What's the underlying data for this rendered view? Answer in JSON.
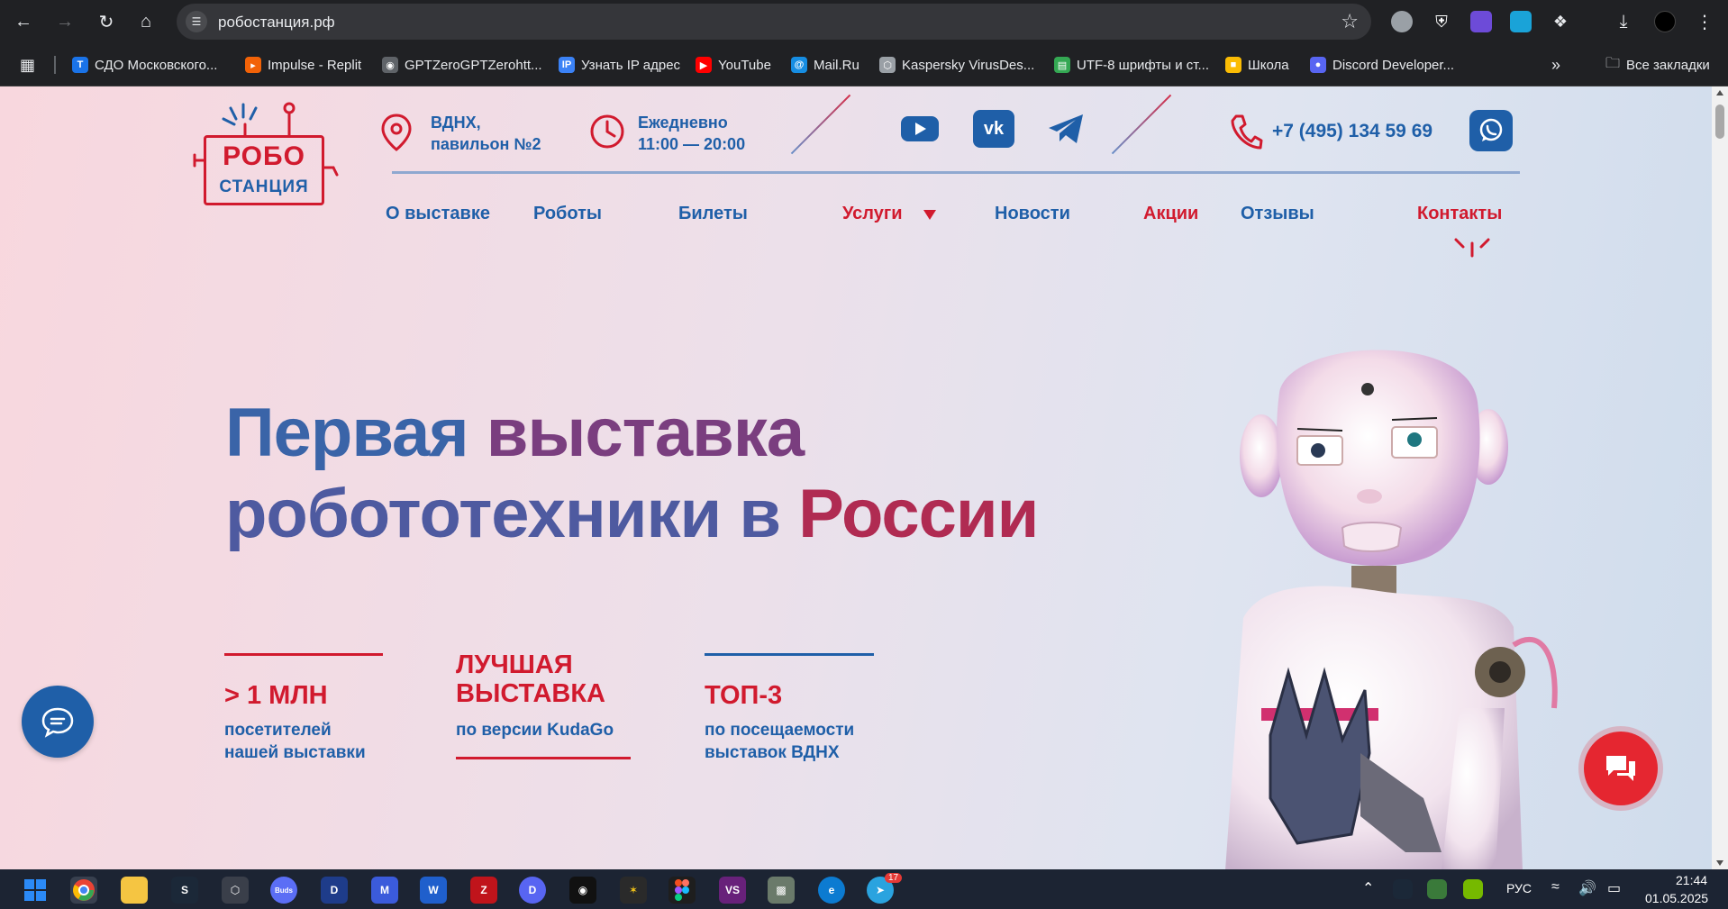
{
  "browser": {
    "url": "робостанция.рф",
    "bookmarks": [
      {
        "label": "СДО Московского...",
        "icon": "sdo-icon",
        "color": "#1a73e8"
      },
      {
        "label": "Impulse - Replit",
        "icon": "replit-icon",
        "color": "#f26207"
      },
      {
        "label": "GPTZeroGPTZerohtt...",
        "icon": "globe-icon",
        "color": "#5f6368"
      },
      {
        "label": "Узнать IP адрес",
        "icon": "ip-icon",
        "color": "#3b82f6"
      },
      {
        "label": "YouTube",
        "icon": "youtube-icon",
        "color": "#ff0000"
      },
      {
        "label": "Mail.Ru",
        "icon": "mailru-icon",
        "color": "#168de2"
      },
      {
        "label": "Kaspersky VirusDes...",
        "icon": "kaspersky-icon",
        "color": "#9aa0a6"
      },
      {
        "label": "UTF-8 шрифты и ст...",
        "icon": "doc-icon",
        "color": "#34a853"
      },
      {
        "label": "Школа",
        "icon": "school-icon",
        "color": "#fbbc04"
      },
      {
        "label": "Discord Developer...",
        "icon": "discord-icon",
        "color": "#5865f2"
      }
    ],
    "more_label": "»",
    "all_bookmarks": "Все закладки"
  },
  "site": {
    "logo": {
      "line1": "РОБО",
      "line2": "СТАНЦИЯ"
    },
    "address": {
      "line1": "ВДНХ,",
      "line2": "павильон №2"
    },
    "hours": {
      "line1": "Ежедневно",
      "line2": "11:00 — 20:00"
    },
    "phone": "+7 (495) 134 59 69",
    "menu": [
      {
        "label": "О выставке",
        "color": "blue"
      },
      {
        "label": "Роботы",
        "color": "blue"
      },
      {
        "label": "Билеты",
        "color": "blue"
      },
      {
        "label": "Услуги",
        "color": "red"
      },
      {
        "label": "Новости",
        "color": "blue"
      },
      {
        "label": "Акции",
        "color": "red"
      },
      {
        "label": "Отзывы",
        "color": "blue"
      },
      {
        "label": "Контакты",
        "color": "red"
      }
    ],
    "hero": {
      "w1": "Первая",
      "w2": "выставка",
      "w3": "робототехники в",
      "w4": "России"
    },
    "stats": [
      {
        "big1": "> 1 МЛН",
        "big2": "",
        "small1": "посетителей",
        "small2": "нашей выставки"
      },
      {
        "big1": "ЛУЧШАЯ",
        "big2": "ВЫСТАВКА",
        "small1": "по версии KudaGo",
        "small2": ""
      },
      {
        "big1": "ТОП-3",
        "big2": "",
        "small1": "по посещаемости",
        "small2": "выставок ВДНХ"
      }
    ],
    "colors": {
      "brand_red": "#d11a2e",
      "brand_blue": "#1f5fa8"
    }
  },
  "taskbar": {
    "lang": "РУС",
    "time": "21:44",
    "date": "01.05.2025",
    "telegram_badge": "17"
  }
}
